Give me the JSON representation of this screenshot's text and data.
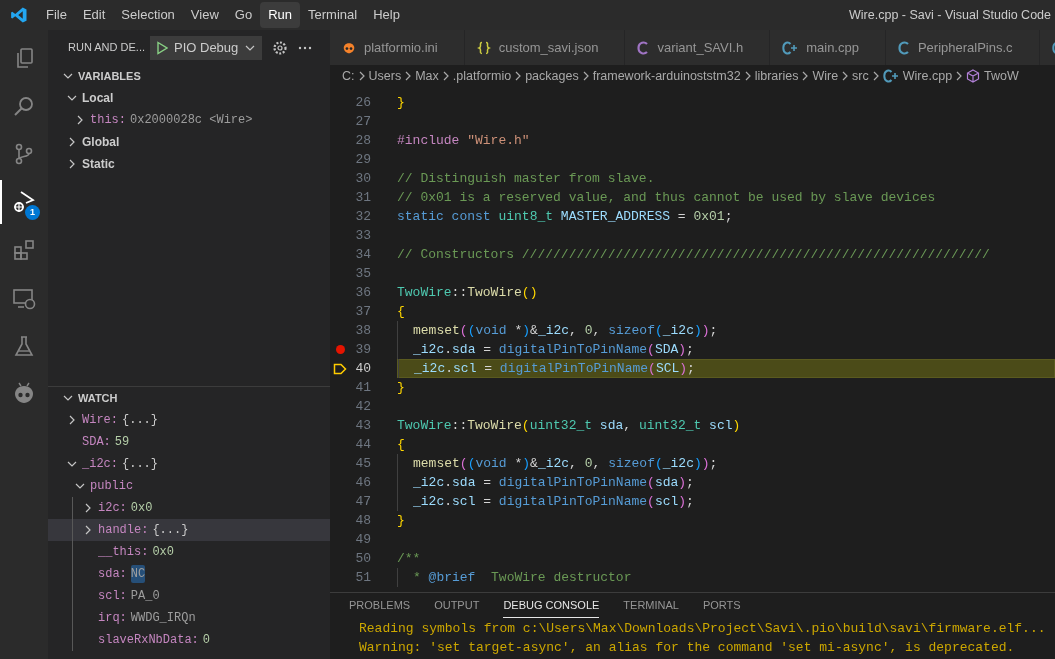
{
  "menu": [
    {
      "label": "File",
      "selected": false
    },
    {
      "label": "Edit",
      "selected": false
    },
    {
      "label": "Selection",
      "selected": false
    },
    {
      "label": "View",
      "selected": false
    },
    {
      "label": "Go",
      "selected": false
    },
    {
      "label": "Run",
      "selected": true
    },
    {
      "label": "Terminal",
      "selected": false
    },
    {
      "label": "Help",
      "selected": false
    }
  ],
  "window": {
    "title": "Wire.cpp - Savi - Visual Studio Code"
  },
  "activity_bar": [
    {
      "kind": "explorer",
      "selected": false
    },
    {
      "kind": "search",
      "selected": false
    },
    {
      "kind": "source-control",
      "selected": false
    },
    {
      "kind": "debug",
      "selected": true,
      "badge": "1"
    },
    {
      "kind": "extensions",
      "selected": false
    },
    {
      "kind": "remote",
      "selected": false
    },
    {
      "kind": "testing",
      "selected": false
    },
    {
      "kind": "platformio",
      "selected": false
    }
  ],
  "sidebar": {
    "title": "RUN AND DE...",
    "configuration": "PIO Debug",
    "variables": {
      "title": "VARIABLES",
      "expanded": true,
      "scopes": [
        {
          "label": "Local",
          "expanded": true,
          "children": [
            {
              "name": "this:",
              "value": "0x2000028c <Wire>",
              "kind": "text",
              "expanded": false
            }
          ]
        },
        {
          "label": "Global",
          "expanded": false
        },
        {
          "label": "Static",
          "expanded": false
        }
      ]
    },
    "watch": {
      "title": "WATCH",
      "expanded": true,
      "items": [
        {
          "name": "Wire:",
          "value": "{...}",
          "kind": "object",
          "expanded": false,
          "selected": false,
          "highlighted": false
        },
        {
          "name": "SDA:",
          "value": "59",
          "kind": "number",
          "selected": false,
          "highlighted": false
        },
        {
          "name": "_i2c:",
          "value": "{...}",
          "kind": "object",
          "expanded": true,
          "selected": false,
          "highlighted": false,
          "children": [
            {
              "name": "public",
              "expanded": true,
              "selected": false,
              "children": [
                {
                  "name": "i2c:",
                  "value": "0x0",
                  "kind": "number",
                  "expanded": false,
                  "selected": false,
                  "highlighted": false
                },
                {
                  "name": "handle:",
                  "value": "{...}",
                  "kind": "object",
                  "expanded": false,
                  "selected": true,
                  "highlighted": false
                },
                {
                  "name": "__this:",
                  "value": "0x0",
                  "kind": "number",
                  "selected": false,
                  "highlighted": false
                },
                {
                  "name": "sda:",
                  "value": "NC",
                  "kind": "text",
                  "selected": false,
                  "highlighted": true
                },
                {
                  "name": "scl:",
                  "value": "PA_0",
                  "kind": "text",
                  "selected": false,
                  "highlighted": false
                },
                {
                  "name": "irq:",
                  "value": "WWDG_IRQn",
                  "kind": "text",
                  "selected": false,
                  "highlighted": false
                },
                {
                  "name": "slaveRxNbData:",
                  "value": "0",
                  "kind": "number",
                  "selected": false,
                  "highlighted": false
                }
              ]
            }
          ]
        }
      ]
    }
  },
  "tabs": [
    {
      "label": "platformio.ini",
      "kind": "pio"
    },
    {
      "label": "custom_savi.json",
      "kind": "json"
    },
    {
      "label": "variant_SAVI.h",
      "kind": "c-purple"
    },
    {
      "label": "main.cpp",
      "kind": "cpp"
    },
    {
      "label": "PeripheralPins.c",
      "kind": "c"
    },
    {
      "kind": "cpp"
    }
  ],
  "breadcrumbs": [
    {
      "label": "C:"
    },
    {
      "label": "Users"
    },
    {
      "label": "Max"
    },
    {
      "label": ".platformio"
    },
    {
      "label": "packages"
    },
    {
      "label": "framework-arduinoststm32"
    },
    {
      "label": "libraries"
    },
    {
      "label": "Wire"
    },
    {
      "label": "src"
    },
    {
      "label": "Wire.cpp",
      "kind": "cpp"
    },
    {
      "label": "TwoW",
      "kind": "class"
    }
  ],
  "code": [
    {
      "n": "26",
      "tokens": [
        {
          "t": "}",
          "kind": "b1"
        }
      ]
    },
    {
      "n": "27"
    },
    {
      "n": "28",
      "tokens": [
        {
          "t": "#include ",
          "kind": "pre"
        },
        {
          "t": "\"Wire.h\"",
          "kind": "str"
        }
      ]
    },
    {
      "n": "29"
    },
    {
      "n": "30",
      "tokens": [
        {
          "t": "// Distinguish master from slave.",
          "kind": "com"
        }
      ]
    },
    {
      "n": "31",
      "tokens": [
        {
          "t": "// 0x01 is a reserved value, and thus cannot be used by slave devices",
          "kind": "com"
        }
      ]
    },
    {
      "n": "32",
      "tokens": [
        {
          "t": "static ",
          "kind": "kw"
        },
        {
          "t": "const ",
          "kind": "kw"
        },
        {
          "t": "uint8_t ",
          "kind": "type"
        },
        {
          "t": "MASTER_ADDRESS",
          "kind": "var"
        },
        {
          "t": " = ",
          "kind": "plain"
        },
        {
          "t": "0x01",
          "kind": "num"
        },
        {
          "t": ";",
          "kind": "plain"
        }
      ]
    },
    {
      "n": "33"
    },
    {
      "n": "34",
      "tokens": [
        {
          "t": "// Constructors ////////////////////////////////////////////////////////////",
          "kind": "com"
        }
      ]
    },
    {
      "n": "35"
    },
    {
      "n": "36",
      "tokens": [
        {
          "t": "TwoWire",
          "kind": "type"
        },
        {
          "t": "::",
          "kind": "plain"
        },
        {
          "t": "TwoWire",
          "kind": "fn"
        },
        {
          "t": "()",
          "kind": "b1"
        }
      ]
    },
    {
      "n": "37",
      "tokens": [
        {
          "t": "{",
          "kind": "b1"
        }
      ]
    },
    {
      "n": "38",
      "indented": true,
      "tokens": [
        {
          "t": "memset",
          "kind": "fn"
        },
        {
          "t": "(",
          "kind": "b2"
        },
        {
          "t": "(",
          "kind": "b3"
        },
        {
          "t": "void",
          "kind": "kw"
        },
        {
          "t": " *",
          "kind": "plain"
        },
        {
          "t": ")",
          "kind": "b3"
        },
        {
          "t": "&",
          "kind": "plain"
        },
        {
          "t": "_i2c",
          "kind": "var"
        },
        {
          "t": ", ",
          "kind": "plain"
        },
        {
          "t": "0",
          "kind": "num"
        },
        {
          "t": ", ",
          "kind": "plain"
        },
        {
          "t": "sizeof",
          "kind": "kw"
        },
        {
          "t": "(",
          "kind": "b3"
        },
        {
          "t": "_i2c",
          "kind": "var"
        },
        {
          "t": ")",
          "kind": "b3"
        },
        {
          "t": ")",
          "kind": "b2"
        },
        {
          "t": ";",
          "kind": "plain"
        }
      ]
    },
    {
      "n": "39",
      "indented": true,
      "kind": "breakpoint",
      "tokens": [
        {
          "t": "_i2c",
          "kind": "var"
        },
        {
          "t": ".",
          "kind": "plain"
        },
        {
          "t": "sda",
          "kind": "var"
        },
        {
          "t": " = ",
          "kind": "plain"
        },
        {
          "t": "digitalPinToPinName",
          "kind": "kw"
        },
        {
          "t": "(",
          "kind": "b2"
        },
        {
          "t": "SDA",
          "kind": "var"
        },
        {
          "t": ")",
          "kind": "b2"
        },
        {
          "t": ";",
          "kind": "plain"
        }
      ]
    },
    {
      "n": "40",
      "indented": true,
      "kind": "current",
      "tokens": [
        {
          "t": "_i2c",
          "kind": "var"
        },
        {
          "t": ".",
          "kind": "plain"
        },
        {
          "t": "scl",
          "kind": "var"
        },
        {
          "t": " = ",
          "kind": "plain"
        },
        {
          "t": "digitalPinToPinName",
          "kind": "kw"
        },
        {
          "t": "(",
          "kind": "b2"
        },
        {
          "t": "SCL",
          "kind": "var"
        },
        {
          "t": ")",
          "kind": "b2"
        },
        {
          "t": ";",
          "kind": "plain"
        }
      ]
    },
    {
      "n": "41",
      "tokens": [
        {
          "t": "}",
          "kind": "b1"
        }
      ]
    },
    {
      "n": "42"
    },
    {
      "n": "43",
      "tokens": [
        {
          "t": "TwoWire",
          "kind": "type"
        },
        {
          "t": "::",
          "kind": "plain"
        },
        {
          "t": "TwoWire",
          "kind": "fn"
        },
        {
          "t": "(",
          "kind": "b1"
        },
        {
          "t": "uint32_t ",
          "kind": "type"
        },
        {
          "t": "sda",
          "kind": "var"
        },
        {
          "t": ", ",
          "kind": "plain"
        },
        {
          "t": "uint32_t ",
          "kind": "type"
        },
        {
          "t": "scl",
          "kind": "var"
        },
        {
          "t": ")",
          "kind": "b1"
        }
      ]
    },
    {
      "n": "44",
      "tokens": [
        {
          "t": "{",
          "kind": "b1"
        }
      ]
    },
    {
      "n": "45",
      "indented": true,
      "tokens": [
        {
          "t": "memset",
          "kind": "fn"
        },
        {
          "t": "(",
          "kind": "b2"
        },
        {
          "t": "(",
          "kind": "b3"
        },
        {
          "t": "void",
          "kind": "kw"
        },
        {
          "t": " *",
          "kind": "plain"
        },
        {
          "t": ")",
          "kind": "b3"
        },
        {
          "t": "&",
          "kind": "plain"
        },
        {
          "t": "_i2c",
          "kind": "var"
        },
        {
          "t": ", ",
          "kind": "plain"
        },
        {
          "t": "0",
          "kind": "num"
        },
        {
          "t": ", ",
          "kind": "plain"
        },
        {
          "t": "sizeof",
          "kind": "kw"
        },
        {
          "t": "(",
          "kind": "b3"
        },
        {
          "t": "_i2c",
          "kind": "var"
        },
        {
          "t": ")",
          "kind": "b3"
        },
        {
          "t": ")",
          "kind": "b2"
        },
        {
          "t": ";",
          "kind": "plain"
        }
      ]
    },
    {
      "n": "46",
      "indented": true,
      "tokens": [
        {
          "t": "_i2c",
          "kind": "var"
        },
        {
          "t": ".",
          "kind": "plain"
        },
        {
          "t": "sda",
          "kind": "var"
        },
        {
          "t": " = ",
          "kind": "plain"
        },
        {
          "t": "digitalPinToPinName",
          "kind": "kw"
        },
        {
          "t": "(",
          "kind": "b2"
        },
        {
          "t": "sda",
          "kind": "var"
        },
        {
          "t": ")",
          "kind": "b2"
        },
        {
          "t": ";",
          "kind": "plain"
        }
      ]
    },
    {
      "n": "47",
      "indented": true,
      "tokens": [
        {
          "t": "_i2c",
          "kind": "var"
        },
        {
          "t": ".",
          "kind": "plain"
        },
        {
          "t": "scl",
          "kind": "var"
        },
        {
          "t": " = ",
          "kind": "plain"
        },
        {
          "t": "digitalPinToPinName",
          "kind": "kw"
        },
        {
          "t": "(",
          "kind": "b2"
        },
        {
          "t": "scl",
          "kind": "var"
        },
        {
          "t": ")",
          "kind": "b2"
        },
        {
          "t": ";",
          "kind": "plain"
        }
      ]
    },
    {
      "n": "48",
      "tokens": [
        {
          "t": "}",
          "kind": "b1"
        }
      ]
    },
    {
      "n": "49"
    },
    {
      "n": "50",
      "tokens": [
        {
          "t": "/**",
          "kind": "com"
        }
      ]
    },
    {
      "n": "51",
      "indented": true,
      "tokens": [
        {
          "t": "* ",
          "kind": "com"
        },
        {
          "t": "@brief",
          "kind": "kw"
        },
        {
          "t": "  TwoWire destructor",
          "kind": "com"
        }
      ]
    }
  ],
  "panel": {
    "tabs": [
      {
        "label": "PROBLEMS",
        "selected": false
      },
      {
        "label": "OUTPUT",
        "selected": false
      },
      {
        "label": "DEBUG CONSOLE",
        "selected": true
      },
      {
        "label": "TERMINAL",
        "selected": false
      },
      {
        "label": "PORTS",
        "selected": false
      }
    ],
    "console": [
      "Reading symbols from c:\\Users\\Max\\Downloads\\Project\\Savi\\.pio\\build\\savi\\firmware.elf...",
      "Warning: 'set target-async', an alias for the command 'set mi-async', is deprecated."
    ]
  }
}
